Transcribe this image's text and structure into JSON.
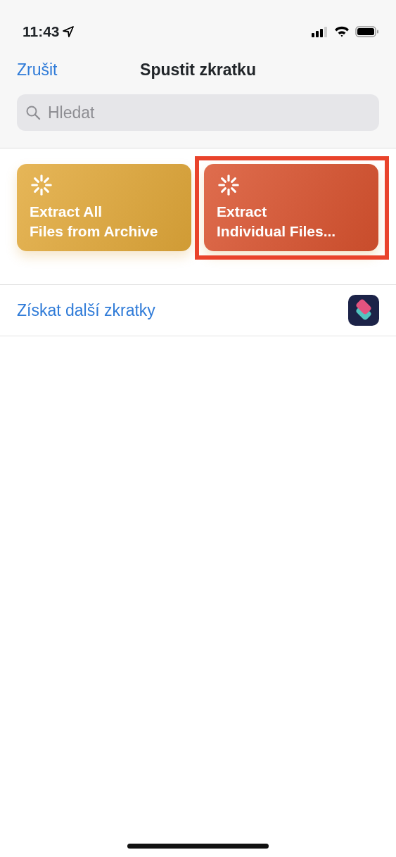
{
  "status_bar": {
    "time": "11:43"
  },
  "nav": {
    "cancel": "Zrušit",
    "title": "Spustit zkratku"
  },
  "search": {
    "placeholder": "Hledat"
  },
  "shortcuts": [
    {
      "lines": [
        "Extract All",
        "Files from Archive"
      ],
      "color": "#e2a93a",
      "highlighted": false
    },
    {
      "lines": [
        "Extract",
        "Individual Files..."
      ],
      "color": "#d9532f",
      "highlighted": true
    }
  ],
  "more_link": {
    "label": "Získat další zkratky"
  }
}
